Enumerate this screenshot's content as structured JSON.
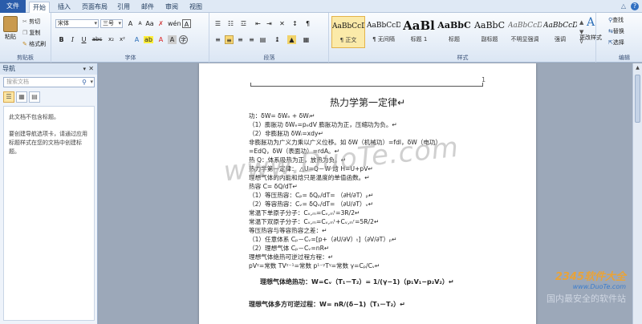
{
  "tabs": [
    {
      "label": "文件",
      "kind": "file"
    },
    {
      "label": "开始",
      "kind": "active"
    },
    {
      "label": "插入",
      "kind": ""
    },
    {
      "label": "页面布局",
      "kind": ""
    },
    {
      "label": "引用",
      "kind": ""
    },
    {
      "label": "邮件",
      "kind": ""
    },
    {
      "label": "审阅",
      "kind": ""
    },
    {
      "label": "视图",
      "kind": ""
    }
  ],
  "ribbon": {
    "clipboard": {
      "paste": "粘贴",
      "cut": "剪切",
      "copy": "复制",
      "format_painter": "格式刷",
      "group": "剪贴板"
    },
    "font": {
      "name": "宋体",
      "size": "三号",
      "group": "字体",
      "bold": "B",
      "italic": "I",
      "underline": "U",
      "strike": "abc",
      "sub": "x₂",
      "sup": "x²"
    },
    "paragraph": {
      "group": "段落"
    },
    "styles": {
      "group": "样式",
      "items": [
        {
          "sample": "AaBbCcDc",
          "name": "¶ 正文",
          "selected": true
        },
        {
          "sample": "AaBbCcDc",
          "name": "¶ 无间隔",
          "selected": false
        },
        {
          "sample": "AaBl",
          "name": "标题 1",
          "selected": false
        },
        {
          "sample": "AaBbC",
          "name": "标题",
          "selected": false
        },
        {
          "sample": "AaBbC",
          "name": "副标题",
          "selected": false
        },
        {
          "sample": "AaBbCcDc",
          "name": "不明显强调",
          "selected": false
        },
        {
          "sample": "AaBbCcDc",
          "name": "强调",
          "selected": false
        }
      ],
      "change_styles": "更改样式"
    },
    "editing": {
      "group": "编辑",
      "find": "查找",
      "replace": "替换",
      "select": "选择"
    }
  },
  "nav": {
    "title": "导航",
    "search_placeholder": "搜索文档",
    "message1": "此文档不包含标题。",
    "message2": "要创建导航选项卡，请通过应用标题样式在您的文档中创建标题。"
  },
  "doc": {
    "page_number": "1",
    "title": "热力学第一定律↵",
    "lines": [
      "功：δW= δWₑ + δWᵢ↵",
      "（1）膨胀功  δWₑ=pₑdV      膨胀功为正，压缩功为负。↵",
      "（2）非膨胀功 δWᵢ=xdy↵",
      "        非膨胀功为广义力乘以广义位移。如 δW（机械功）=fdl，δW（电功）",
      "        =EdQ，δW（表面功）=rdA。↵",
      "热 Q：体系吸热为正，放热为负。↵",
      "热力学第一定律：  △U=Q－W          焓  H=U+pV↵",
      "理想气体的内能和焓只是温度的单值函数。↵",
      "热容      C= δQ/dT↵",
      "（1）等压热容：Cₚ= δQₚ/dT=  （∂H/∂T）ₚ↵",
      "（2）等容热容：Cᵥ= δQᵥ/dT=  （∂U/∂T）ᵥ↵",
      "常温下单原子分子：Cᵥ,ₘ=Cᵥ,ₘᵗ=3R/2↵",
      "常温下双原子分子：Cᵥ,ₘ=Cᵥ,ₘᵗ+Cᵥ,ₘʳ=5R/2↵",
      "等压热容与等容热容之差：↵",
      "（1）任意体系     Cₚ－Cᵥ=[p+（∂U/∂V）ₜ]（∂V/∂T）ₚ↵",
      "（2）理想气体     Cₚ－Cᵥ=nR↵",
      "理想气体绝热可逆过程方程：↵",
      "     pVᵞ=常数   TVᵞ⁻¹=常数      p¹⁻ᵞTᵞ=常数   γ=Cₚ/Cᵥ↵"
    ],
    "bold_lines": [
      "理想气体绝热功：W=Cᵥ（T₁－T₂）= 1/(γ−1)（p₁V₁−p₂V₂）↵",
      "理想气体多方可逆过程：W= nR/(δ−1)（T₁－T₂）↵"
    ]
  },
  "watermark": {
    "main": "www.DuoTe.com",
    "brand": "2345软件大全",
    "site": "www.DuoTe.com",
    "slogan": "国内最安全的软件站"
  }
}
